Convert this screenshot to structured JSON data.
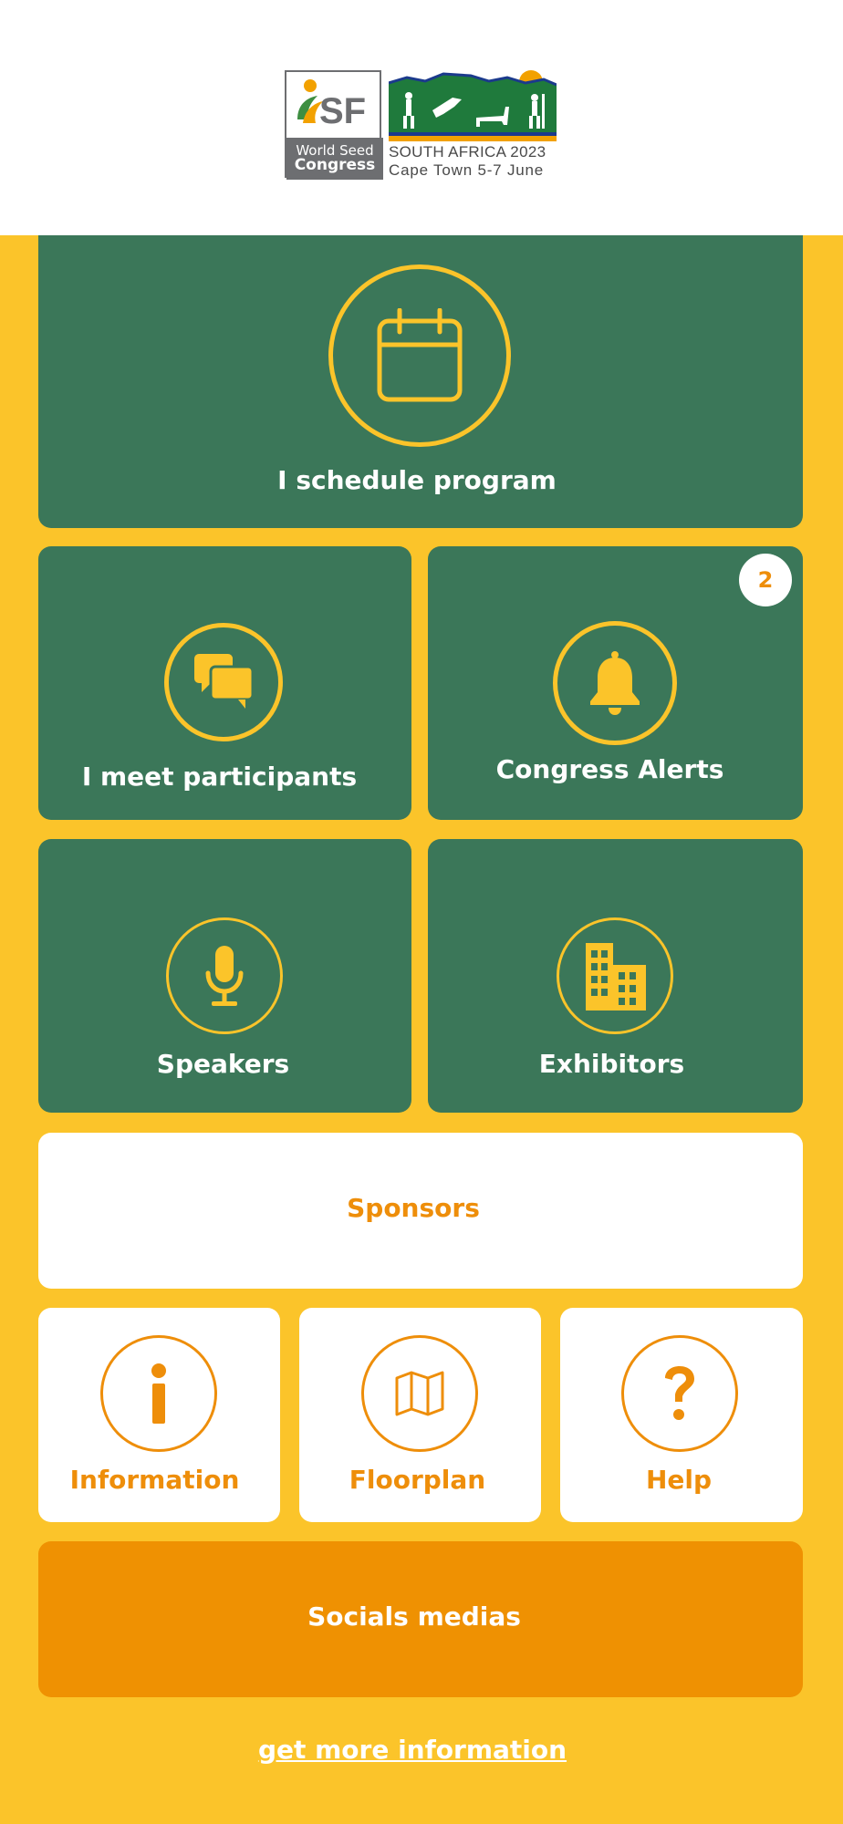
{
  "header": {
    "isf_line1": "World Seed",
    "isf_line2": "Congress",
    "event_line1": "SOUTH AFRICA 2023",
    "event_line2": "Cape Town 5-7 June"
  },
  "tiles": {
    "schedule": {
      "label": "I schedule program",
      "icon": "calendar-icon"
    },
    "meet": {
      "label": "I meet participants",
      "icon": "chat-bubbles-icon"
    },
    "alerts": {
      "label": "Congress Alerts",
      "icon": "bell-icon",
      "badge": "2"
    },
    "speakers": {
      "label": "Speakers",
      "icon": "microphone-icon"
    },
    "exhibitors": {
      "label": "Exhibitors",
      "icon": "building-icon"
    },
    "sponsors": {
      "label": "Sponsors"
    },
    "information": {
      "label": "Information",
      "icon": "info-icon"
    },
    "floorplan": {
      "label": "Floorplan",
      "icon": "map-icon"
    },
    "help": {
      "label": "Help",
      "icon": "question-icon"
    },
    "socials": {
      "label": "Socials medias"
    }
  },
  "footer": {
    "link": "get more information"
  },
  "colors": {
    "background": "#FBC42A",
    "tile_green": "#3B7759",
    "accent_orange": "#EF9102",
    "white": "#FFFFFF"
  }
}
